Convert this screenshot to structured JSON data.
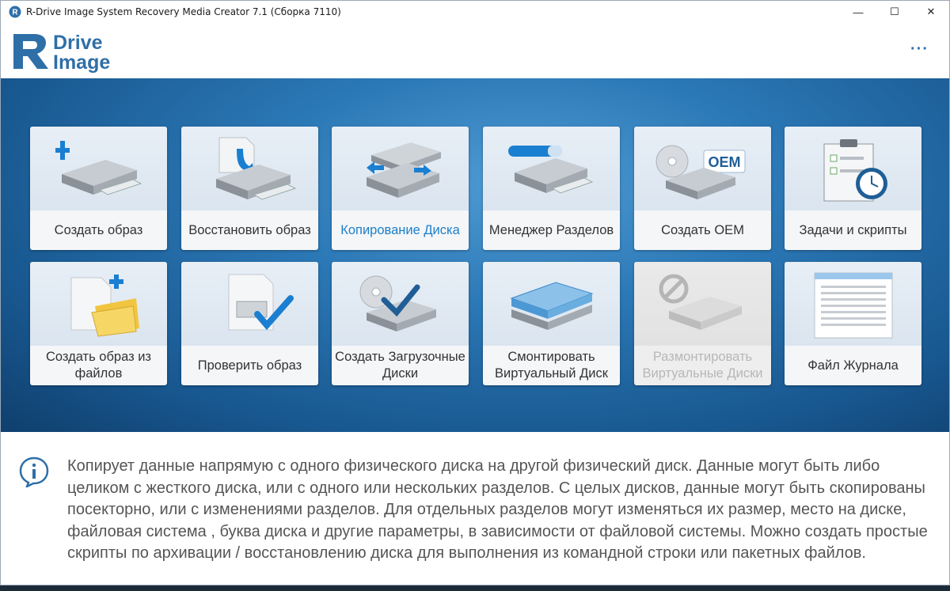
{
  "window": {
    "title": "R-Drive Image System Recovery Media Creator 7.1 (Сборка 7110)",
    "minimize_glyph": "—",
    "maximize_glyph": "☐",
    "close_glyph": "✕"
  },
  "header": {
    "logo_line1": "Drive",
    "logo_line2": "Image",
    "logo_letter": "R",
    "menu_glyph": "···"
  },
  "tiles": [
    {
      "label": "Создать образ",
      "icon": "create-image-icon"
    },
    {
      "label": "Восстановить образ",
      "icon": "restore-image-icon"
    },
    {
      "label": "Копирование Диска",
      "icon": "copy-disk-icon",
      "active": true
    },
    {
      "label": "Менеджер Разделов",
      "icon": "partition-manager-icon"
    },
    {
      "label": "Создать OEM",
      "icon": "create-oem-icon",
      "badge": "OEM"
    },
    {
      "label": "Задачи и скрипты",
      "icon": "tasks-scripts-icon"
    },
    {
      "label": "Создать образ из файлов",
      "icon": "image-from-files-icon"
    },
    {
      "label": "Проверить образ",
      "icon": "verify-image-icon"
    },
    {
      "label": "Создать Загрузочные Диски",
      "icon": "boot-disks-icon"
    },
    {
      "label": "Смонтировать Виртуальный Диск",
      "icon": "mount-virtual-disk-icon"
    },
    {
      "label": "Размонтировать Виртуальные Диски",
      "icon": "unmount-virtual-disks-icon",
      "disabled": true
    },
    {
      "label": "Файл Журнала",
      "icon": "log-file-icon"
    }
  ],
  "info": {
    "icon": "info-icon",
    "text": "Копирует данные напрямую с одного физического диска на другой физический диск. Данные могут быть либо целиком с жесткого диска, или с одного или нескольких разделов. С целых дисков, данные могут быть скопированы посекторно, или с изменениями разделов. Для отдельных разделов могут изменяться их размер, место на диске, файловая система , буква диска и другие параметры, в зависимости от файловой системы. Можно создать простые скрипты по архивации / восстановлению диска для выполнения из командной строки или пакетных файлов."
  },
  "colors": {
    "accent": "#1d7fc9",
    "stage_mid": "#2b78b6",
    "stage_dark": "#0f3f6d",
    "disabled_text": "#b7b7b7"
  }
}
